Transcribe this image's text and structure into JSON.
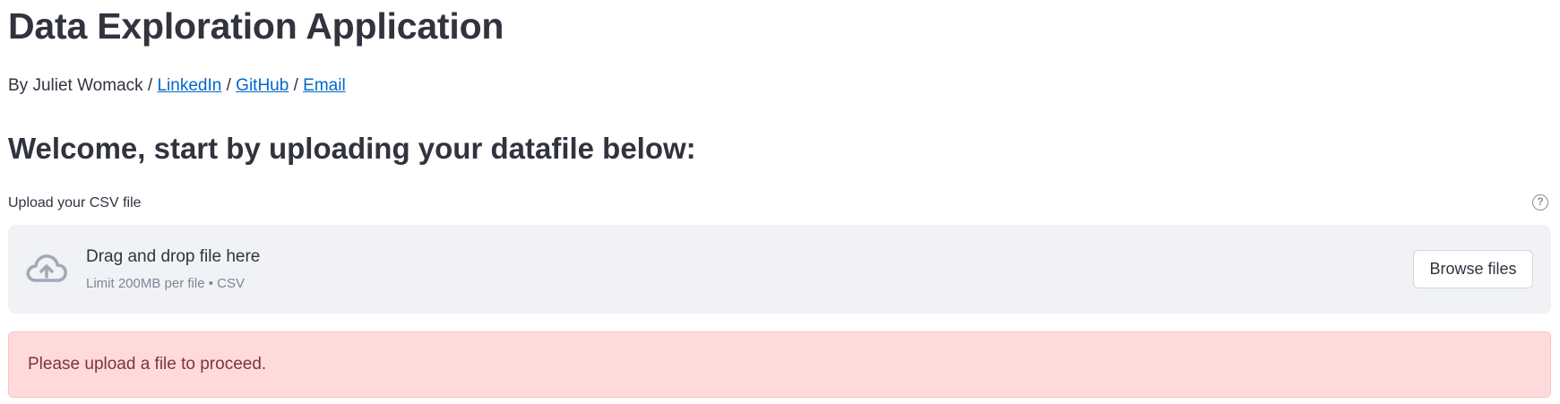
{
  "header": {
    "title": "Data Exploration Application",
    "byline_prefix": "By Juliet Womack /",
    "separator": "/",
    "links": {
      "linkedin": "LinkedIn",
      "github": "GitHub",
      "email": "Email"
    }
  },
  "welcome": {
    "heading": "Welcome, start by uploading your datafile below:"
  },
  "uploader": {
    "label": "Upload your CSV file",
    "help_icon": "question-circle-icon",
    "help_glyph": "?",
    "drop_icon": "cloud-upload-icon",
    "drop_text": "Drag and drop file here",
    "limit_text": "Limit 200MB per file • CSV",
    "browse_label": "Browse files"
  },
  "alert": {
    "message": "Please upload a file to proceed.",
    "background": "#ffdada",
    "text_color": "#7d353b"
  },
  "colors": {
    "text": "#31333f",
    "link": "#0068c9",
    "dropzone_bg": "#f0f2f6",
    "muted": "#808495"
  }
}
